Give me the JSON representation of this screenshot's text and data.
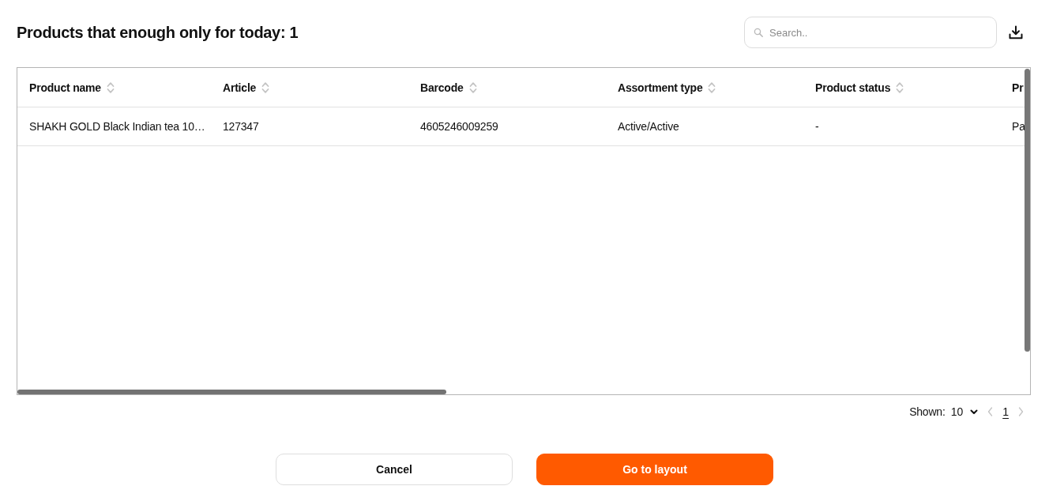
{
  "title": "Products that enough only for today: 1",
  "search": {
    "placeholder": "Search.."
  },
  "table": {
    "columns": [
      {
        "label": "Product name",
        "sortable": true
      },
      {
        "label": "Article",
        "sortable": true
      },
      {
        "label": "Barcode",
        "sortable": true
      },
      {
        "label": "Assortment type",
        "sortable": true
      },
      {
        "label": "Product status",
        "sortable": true
      },
      {
        "label": "Pr",
        "sortable": false
      }
    ],
    "rows": [
      {
        "cells": [
          "SHAKH GOLD Black Indian tea 10…",
          "127347",
          "4605246009259",
          "Active/Active",
          "-",
          "Pa"
        ]
      }
    ]
  },
  "pagination": {
    "shown_label": "Shown:",
    "page_size": "10",
    "pages": [
      {
        "label": "1",
        "selected": true
      }
    ]
  },
  "buttons": [
    {
      "label": "Cancel",
      "kind": "secondary"
    },
    {
      "label": "Go to layout",
      "kind": "primary"
    }
  ]
}
